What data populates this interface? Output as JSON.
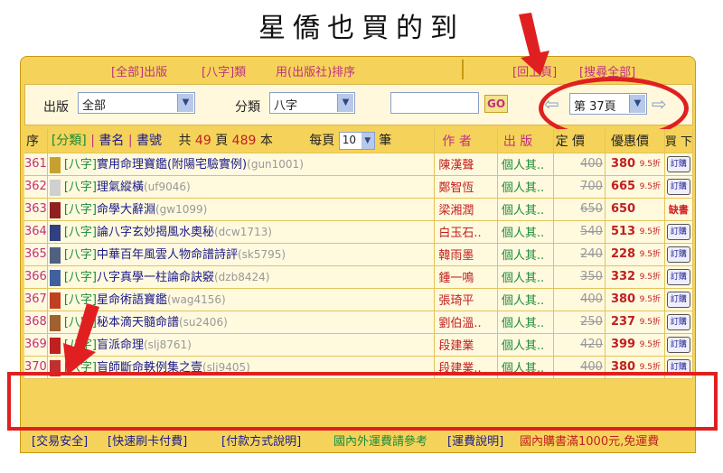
{
  "title": "星僑也買的到",
  "topbar": {
    "all_publishers": "[全部]出版",
    "category": "[八字]類",
    "sort": "用(出版社)排序",
    "back": "[回上頁]",
    "search_all": "[搜尋全部]"
  },
  "filter": {
    "publisher_label": "出版",
    "publisher_value": "全部",
    "category_label": "分類",
    "category_value": "八字",
    "go_label": "GO",
    "page_value": "第 37頁"
  },
  "table_header": {
    "col_no": "序",
    "category": "[分類]",
    "book_title": "書名",
    "book_code": "書號",
    "total_pages_prefix": "共",
    "total_pages": "49",
    "total_pages_unit": "頁",
    "total_books": "489",
    "total_books_unit": "本",
    "per_page_label": "每頁",
    "per_page_value": "10",
    "per_page_unit": "筆",
    "author": "作 者",
    "publisher": "出 版",
    "price": "定 價",
    "sale_price": "優惠價",
    "buy": "買 下"
  },
  "rows": [
    {
      "no": "361",
      "category": "[八字]",
      "title": "實用命理寶鑑(附陽宅驗實例)",
      "code": "(gun1001)",
      "author": "陳漢聲",
      "publisher": "個人其..",
      "price": "400",
      "sale": "380",
      "discount": "9.5折",
      "buy": "訂購"
    },
    {
      "no": "362",
      "category": "[八字]",
      "title": "理氣縱橫",
      "code": "(uf9046)",
      "author": "鄭智恆",
      "publisher": "個人其..",
      "price": "700",
      "sale": "665",
      "discount": "9.5折",
      "buy": "訂購"
    },
    {
      "no": "363",
      "category": "[八字]",
      "title": "命學大辭淵",
      "code": "(gw1099)",
      "author": "梁湘潤",
      "publisher": "個人其..",
      "price": "650",
      "sale": "650",
      "discount": "",
      "buy": "缺書"
    },
    {
      "no": "364",
      "category": "[八字]",
      "title": "論八字玄妙揭風水奧秘",
      "code": "(dcw1713)",
      "author": "白玉石..",
      "publisher": "個人其..",
      "price": "540",
      "sale": "513",
      "discount": "9.5折",
      "buy": "訂購"
    },
    {
      "no": "365",
      "category": "[八字]",
      "title": "中華百年風雲人物命譜詩評",
      "code": "(sk5795)",
      "author": "韓雨墨",
      "publisher": "個人其..",
      "price": "240",
      "sale": "228",
      "discount": "9.5折",
      "buy": "訂購"
    },
    {
      "no": "366",
      "category": "[八字]",
      "title": "八字真學一柱論命訣竅",
      "code": "(dzb8424)",
      "author": "鍾一鳴",
      "publisher": "個人其..",
      "price": "350",
      "sale": "332",
      "discount": "9.5折",
      "buy": "訂購"
    },
    {
      "no": "367",
      "category": "[八字]",
      "title": "星命術語寶鑑",
      "code": "(wag4156)",
      "author": "張琦平",
      "publisher": "個人其..",
      "price": "400",
      "sale": "380",
      "discount": "9.5折",
      "buy": "訂購"
    },
    {
      "no": "368",
      "category": "[八字]",
      "title": "秘本滴天髓命譜",
      "code": "(su2406)",
      "author": "劉伯溫..",
      "publisher": "個人其..",
      "price": "250",
      "sale": "237",
      "discount": "9.5折",
      "buy": "訂購"
    },
    {
      "no": "369",
      "category": "[八字]",
      "title": "盲派命理",
      "code": "(slj8761)",
      "author": "段建業",
      "publisher": "個人其..",
      "price": "420",
      "sale": "399",
      "discount": "9.5折",
      "buy": "訂購"
    },
    {
      "no": "370",
      "category": "[八字]",
      "title": "盲師斷命軼例集之壹",
      "code": "(slj9405)",
      "author": "段建業..",
      "publisher": "個人其..",
      "price": "400",
      "sale": "380",
      "discount": "9.5折",
      "buy": "訂購"
    }
  ],
  "footer": {
    "safe": "[交易安全]",
    "quick_pay": "[快速刷卡付費]",
    "pay_method": "[付款方式說明]",
    "shipping_ref": "國內外運費請參考",
    "shipping_note": "[運費說明]",
    "free_ship": "國內購書滿1000元,免運費"
  },
  "colors": {
    "frame": "#f5d35a",
    "row_bg": "#fff9de",
    "accent_red": "#e02020",
    "link_pink": "#c03080",
    "title_blue": "#1a1a8a",
    "category_green": "#1a8a3a"
  }
}
